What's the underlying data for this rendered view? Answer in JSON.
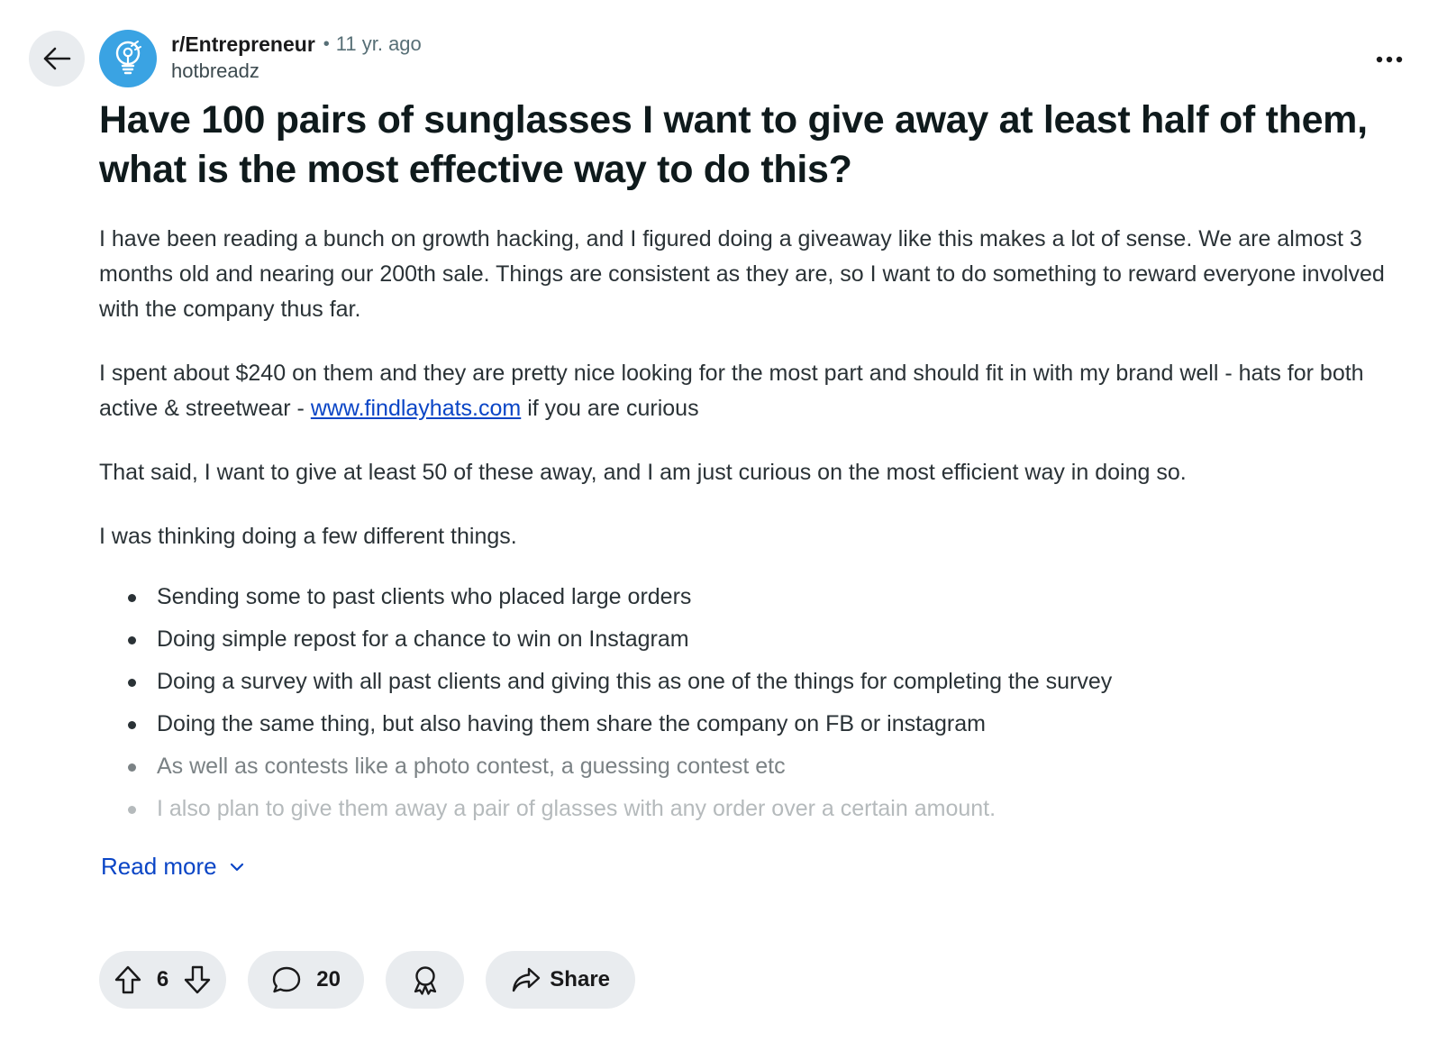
{
  "header": {
    "subreddit": "r/Entrepreneur",
    "separator": "•",
    "age": "11 yr. ago",
    "author": "hotbreadz"
  },
  "post": {
    "title": "Have 100 pairs of sunglasses I want to give away at least half of them, what is the most effective way to do this?",
    "paragraphs": [
      "I have been reading a bunch on growth hacking, and I figured doing a giveaway like this makes a lot of sense. We are almost 3 months old and nearing our 200th sale. Things are consistent as they are, so I want to do something to reward everyone involved with the company thus far.",
      "That said, I want to give at least 50 of these away, and I am just curious on the most efficient way in doing so.",
      "I was thinking doing a few different things."
    ],
    "p2_before": "I spent about $240 on them and they are pretty nice looking for the most part and should fit in with my brand well - hats for both active & streetwear - ",
    "p2_link": "www.findlayhats.com",
    "p2_after": " if you are curious",
    "bullets": [
      "Sending some to past clients who placed large orders",
      "Doing simple repost for a chance to win on Instagram",
      "Doing a survey with all past clients and giving this as one of the things for completing the survey",
      "Doing the same thing, but also having them share the company on FB or instagram",
      "As well as contests like a photo contest, a guessing contest etc",
      "I also plan to give them away a pair of glasses with any order over a certain amount."
    ],
    "read_more": "Read more"
  },
  "actions": {
    "vote_count": "6",
    "comment_count": "20",
    "share_label": "Share"
  },
  "icons": {
    "back": "arrow-left-icon",
    "more": "more-horizontal-icon",
    "upvote": "upvote-arrow-icon",
    "downvote": "downvote-arrow-icon",
    "comment": "comment-bubble-icon",
    "award": "award-icon",
    "share": "share-arrow-icon",
    "avatar": "lightbulb-icon"
  },
  "colors": {
    "link": "#0a45c6",
    "avatar_bg": "#3aa3e3",
    "pill_bg": "#e9ecef"
  }
}
